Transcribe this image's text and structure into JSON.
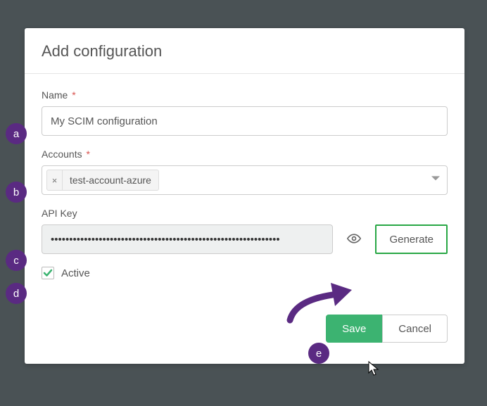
{
  "modal": {
    "title": "Add configuration",
    "name": {
      "label": "Name",
      "required": "*",
      "value": "My SCIM configuration"
    },
    "accounts": {
      "label": "Accounts",
      "required": "*",
      "tag": "test-account-azure"
    },
    "apikey": {
      "label": "API Key",
      "mask": "••••••••••••••••••••••••••••••••••••••••••••••••••••••••••••••",
      "generate": "Generate"
    },
    "active": {
      "label": "Active",
      "checked": true
    },
    "save": "Save",
    "cancel": "Cancel"
  },
  "callouts": {
    "a": "a",
    "b": "b",
    "c": "c",
    "d": "d",
    "e": "e"
  },
  "colors": {
    "accent_green": "#3cb371",
    "callout_purple": "#5a2a82",
    "required_red": "#d9534f"
  }
}
